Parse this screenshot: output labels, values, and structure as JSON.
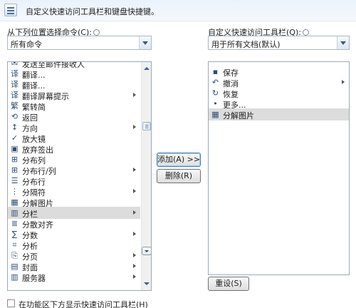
{
  "header": {
    "title": "自定义快速访问工具栏和键盘快捷键。"
  },
  "left": {
    "choose_label": "从下列位置选择命令(C):",
    "choose_value": "所有命令",
    "items": [
      {
        "icon": "send-mail-icon",
        "glyph": "✉",
        "label": "发送至邮件接收人",
        "arrow": false
      },
      {
        "icon": "translate-icon",
        "glyph": "译",
        "label": "翻译...",
        "arrow": false
      },
      {
        "icon": "translate-icon",
        "glyph": "译",
        "label": "翻译...",
        "arrow": false
      },
      {
        "icon": "translation-tip-icon",
        "glyph": "译",
        "label": "翻译屏幕提示",
        "arrow": true
      },
      {
        "icon": "traditional-to-simplified-icon",
        "glyph": "繁",
        "label": "繁转简",
        "arrow": false
      },
      {
        "icon": "return-icon",
        "glyph": "⟲",
        "label": "返回",
        "arrow": false
      },
      {
        "icon": "direction-icon",
        "glyph": "↕",
        "label": "方向",
        "arrow": true
      },
      {
        "icon": "checkmark-icon",
        "glyph": "✓",
        "label": "放大镜",
        "arrow": false
      },
      {
        "icon": "abandon-checkout-icon",
        "glyph": "▣",
        "label": "放弃签出",
        "arrow": false
      },
      {
        "icon": "distribute-columns-icon",
        "glyph": "⊞",
        "label": "分布列",
        "arrow": false
      },
      {
        "icon": "distribute-rows-columns-icon",
        "glyph": "⊞",
        "label": "分布行/列",
        "arrow": true
      },
      {
        "icon": "distribute-rows-icon",
        "glyph": "☰",
        "label": "分布行",
        "arrow": false
      },
      {
        "icon": "separator-icon",
        "glyph": "⋮",
        "label": "分隔符",
        "arrow": true
      },
      {
        "icon": "ungroup-picture-icon",
        "glyph": "▦",
        "label": "分解图片",
        "arrow": false
      },
      {
        "icon": "columns-icon",
        "glyph": "▥",
        "label": "分栏",
        "arrow": true
      },
      {
        "icon": "distributed-align-icon",
        "glyph": "≣",
        "label": "分散对齐",
        "arrow": false
      },
      {
        "icon": "score-icon",
        "glyph": "∑",
        "label": "分数",
        "arrow": true
      },
      {
        "icon": "analysis-icon",
        "glyph": "⌗",
        "label": "分析",
        "arrow": false
      },
      {
        "icon": "page-break-icon",
        "glyph": "⎘",
        "label": "分页",
        "arrow": true
      },
      {
        "icon": "cover-icon",
        "glyph": "▤",
        "label": "封面",
        "arrow": true
      },
      {
        "icon": "server-icon",
        "glyph": "▥",
        "label": "服务器",
        "arrow": true
      }
    ],
    "selected_index": 14
  },
  "right": {
    "customize_label": "自定义快速访问工具栏(Q):",
    "customize_value": "用于所有文档(默认)",
    "items": [
      {
        "icon": "save-icon",
        "glyph": "▪",
        "label": "保存",
        "arrow": false
      },
      {
        "icon": "undo-icon",
        "glyph": "↶",
        "label": "撤消",
        "arrow": true
      },
      {
        "icon": "redo-icon",
        "glyph": "↻",
        "label": "恢复",
        "arrow": false
      },
      {
        "icon": "separator-icon",
        "glyph": "•",
        "label": "更多...",
        "arrow": false
      },
      {
        "icon": "ungroup-picture-icon",
        "glyph": "▦",
        "label": "分解图片",
        "arrow": false
      }
    ],
    "selected_index": 4
  },
  "buttons": {
    "add": "添加(A) >>",
    "remove": "删除(R)",
    "reset": "重设(S)"
  },
  "footer": {
    "checkbox_label": "在功能区下方显示快速访问工具栏(H)"
  }
}
